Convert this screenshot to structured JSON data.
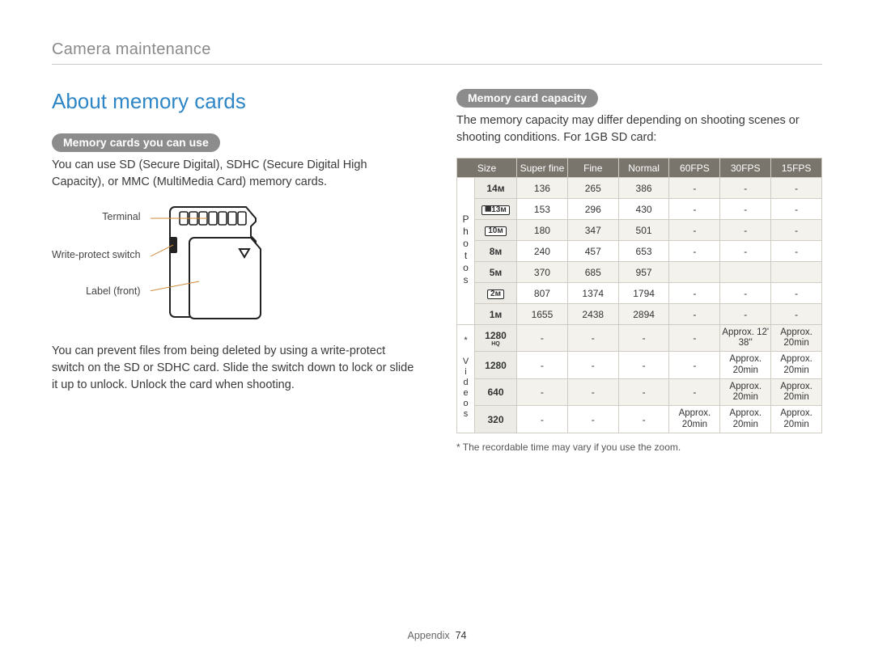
{
  "header": {
    "breadcrumb": "Camera maintenance"
  },
  "left": {
    "title": "About memory cards",
    "pill1": "Memory cards you can use",
    "p1": "You can use SD (Secure Digital), SDHC (Secure Digital High Capacity), or MMC (MultiMedia Card) memory cards.",
    "diagram": {
      "terminal": "Terminal",
      "wps": "Write-protect switch",
      "label": "Label (front)"
    },
    "p2": "You can prevent files from being deleted by using a write-protect switch on the SD or SDHC card. Slide the switch down to lock or slide it up to unlock. Unlock the card when shooting."
  },
  "right": {
    "pill2": "Memory card capacity",
    "intro": "The memory capacity may differ depending on shooting scenes or shooting conditions. For 1GB SD card:",
    "headers": [
      "Size",
      "Super fine",
      "Fine",
      "Normal",
      "60FPS",
      "30FPS",
      "15FPS"
    ],
    "groups": {
      "photos": "Photos",
      "videos": "* Videos"
    },
    "photoRows": [
      {
        "icon": "14ᴍ",
        "sf": "136",
        "f": "265",
        "n": "386",
        "c60": "-",
        "c30": "-",
        "c15": "-"
      },
      {
        "icon": "⯀13ᴍ",
        "boxed": true,
        "sf": "153",
        "f": "296",
        "n": "430",
        "c60": "-",
        "c30": "-",
        "c15": "-"
      },
      {
        "icon": "10ᴍ",
        "boxed": true,
        "sf": "180",
        "f": "347",
        "n": "501",
        "c60": "-",
        "c30": "-",
        "c15": "-"
      },
      {
        "icon": "8ᴍ",
        "sf": "240",
        "f": "457",
        "n": "653",
        "c60": "-",
        "c30": "-",
        "c15": "-"
      },
      {
        "icon": "5ᴍ",
        "sf": "370",
        "f": "685",
        "n": "957",
        "c60": "",
        "c30": "",
        "c15": ""
      },
      {
        "icon": "2ᴍ",
        "boxed": true,
        "sf": "807",
        "f": "1374",
        "n": "1794",
        "c60": "-",
        "c30": "-",
        "c15": "-"
      },
      {
        "icon": "1ᴍ",
        "sf": "1655",
        "f": "2438",
        "n": "2894",
        "c60": "-",
        "c30": "-",
        "c15": "-"
      }
    ],
    "videoRows": [
      {
        "icon": "1280",
        "sub": "HQ",
        "sf": "-",
        "f": "-",
        "n": "-",
        "c60": "-",
        "c30": "Approx. 12' 38''",
        "c15": "Approx. 20min"
      },
      {
        "icon": "1280",
        "sf": "-",
        "f": "-",
        "n": "-",
        "c60": "-",
        "c30": "Approx. 20min",
        "c15": "Approx. 20min"
      },
      {
        "icon": "640",
        "sf": "-",
        "f": "-",
        "n": "-",
        "c60": "-",
        "c30": "Approx. 20min",
        "c15": "Approx. 20min"
      },
      {
        "icon": "320",
        "sf": "-",
        "f": "-",
        "n": "-",
        "c60": "Approx. 20min",
        "c30": "Approx. 20min",
        "c15": "Approx. 20min"
      }
    ],
    "footnote": "* The recordable time may vary if you use the zoom."
  },
  "footer": {
    "section": "Appendix",
    "page": "74"
  }
}
